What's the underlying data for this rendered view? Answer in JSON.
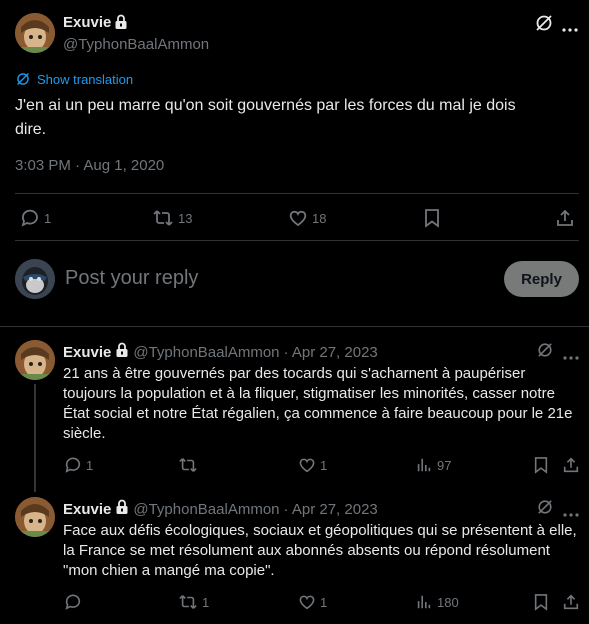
{
  "main_tweet": {
    "author_name": "Exuvie",
    "handle": "@TyphonBaalAmmon",
    "show_translation": "Show translation",
    "text_line1": "J'en ai un peu marre qu'on soit gouvernés par les forces du mal je dois",
    "text_line2": "dire.",
    "timestamp": "3:03 PM · Aug 1, 2020",
    "replies": "1",
    "retweets": "13",
    "likes": "18"
  },
  "composer": {
    "placeholder": "Post your reply",
    "reply_label": "Reply"
  },
  "replies": [
    {
      "author_name": "Exuvie",
      "handle": "@TyphonBaalAmmon",
      "date": "· Apr 27, 2023",
      "text": "21 ans à être gouvernés par des tocards qui s'acharnent à paupériser toujours la population et à la fliquer, stigmatiser les minorités, casser notre État social et notre État régalien, ça commence à faire beaucoup pour le 21e siècle.",
      "replies": "1",
      "retweets": "",
      "likes": "1",
      "views": "97"
    },
    {
      "author_name": "Exuvie",
      "handle": "@TyphonBaalAmmon",
      "date": "· Apr 27, 2023",
      "text": "Face aux défis écologiques, sociaux et géopolitiques qui se présentent à elle, la France se met résolument aux abonnés absents ou répond résolument \"mon chien a mangé ma copie\".",
      "replies": "",
      "retweets": "1",
      "likes": "1",
      "views": "180"
    }
  ],
  "colors": {
    "background": "#000000",
    "text": "#e7e9ea",
    "muted": "#71767b",
    "link": "#1d9bf0",
    "divider": "#2f3336"
  }
}
